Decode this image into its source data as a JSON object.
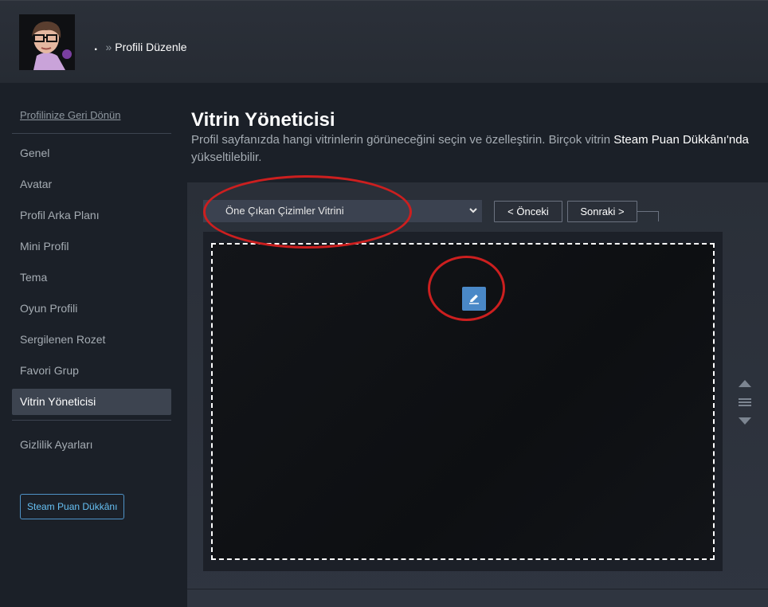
{
  "header": {
    "username": ".",
    "separator": "»",
    "current_page": "Profili Düzenle"
  },
  "sidebar": {
    "back_link": "Profilinize Geri Dönün",
    "items": [
      {
        "label": "Genel"
      },
      {
        "label": "Avatar"
      },
      {
        "label": "Profil Arka Planı"
      },
      {
        "label": "Mini Profil"
      },
      {
        "label": "Tema"
      },
      {
        "label": "Oyun Profili"
      },
      {
        "label": "Sergilenen Rozet"
      },
      {
        "label": "Favori Grup"
      },
      {
        "label": "Vitrin Yöneticisi",
        "active": true
      }
    ],
    "privacy": "Gizlilik Ayarları",
    "points_shop_button": "Steam Puan Dükkânı"
  },
  "main": {
    "title": "Vitrin Yöneticisi",
    "description_part1": "Profil sayfanızda hangi vitrinlerin görüneceğini seçin ve özelleştirin. Birçok vitrin ",
    "description_link": "Steam Puan Dükkânı'nda",
    "description_part2": " yükseltilebilir.",
    "showcase_select_value": "Öne Çıkan Çizimler Vitrini",
    "prev_button": "< Önceki",
    "next_button": "Sonraki >"
  },
  "icons": {
    "edit": "pencil-icon",
    "move_up": "triangle-up-icon",
    "drag": "drag-handle-icon",
    "move_down": "triangle-down-icon",
    "dropdown": "chevron-down-icon"
  },
  "colors": {
    "accent_blue": "#4a88c7",
    "link_blue": "#66c0f4",
    "annotation_red": "#cc1f1f",
    "active_nav": "#3d4450"
  }
}
